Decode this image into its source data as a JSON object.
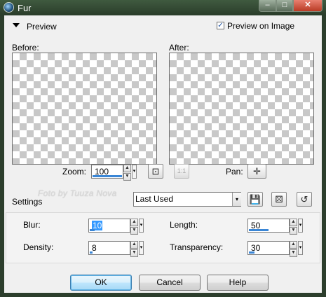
{
  "window": {
    "title": "Fur",
    "controls": {
      "minimize": "–",
      "maximize": "□",
      "close": "✕"
    }
  },
  "preview": {
    "section_label": "Preview",
    "preview_on_image_label": "Preview on Image",
    "preview_on_image_checked": true,
    "before_label": "Before:",
    "after_label": "After:"
  },
  "zoom": {
    "label": "Zoom:",
    "value": "100",
    "level_fraction": 1.0
  },
  "pan": {
    "label": "Pan:"
  },
  "settings": {
    "label": "Settings",
    "preset": "Last Used"
  },
  "watermark": "Foto by Tuuza Nova",
  "params": {
    "blur": {
      "label": "Blur:",
      "value": "10",
      "level_fraction": 0.12
    },
    "length": {
      "label": "Length:",
      "value": "50",
      "level_fraction": 0.5
    },
    "density": {
      "label": "Density:",
      "value": "8",
      "level_fraction": 0.08
    },
    "transparency": {
      "label": "Transparency:",
      "value": "30",
      "level_fraction": 0.15
    }
  },
  "buttons": {
    "ok": "OK",
    "cancel": "Cancel",
    "help": "Help"
  },
  "icons": {
    "spin_up": "▲",
    "spin_down": "▼",
    "dropdown": "▾",
    "fit": "⊡",
    "actual_size": "1:1",
    "pan": "✛",
    "save_preset": "💾",
    "randomize": "⚄",
    "reset": "↺",
    "check": "✓"
  },
  "colors": {
    "accent": "#3a86d6",
    "titlebar": "#2c3e2c",
    "selection": "#3399ff"
  }
}
